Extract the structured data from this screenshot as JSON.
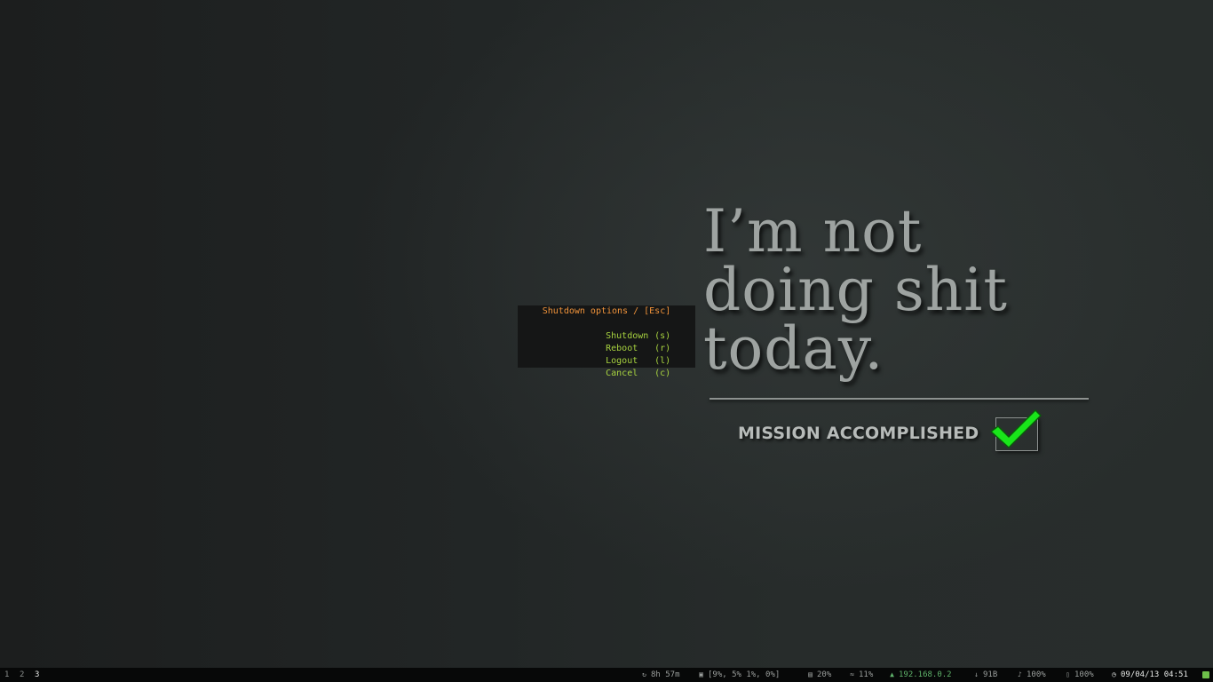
{
  "wallpaper": {
    "headline": [
      "I’m not",
      "doing shit",
      "today."
    ],
    "tagline": "MISSION ACCOMPLISHED",
    "check_color": "#19e61a"
  },
  "dialog": {
    "title": "Shutdown options / [Esc]",
    "items": [
      {
        "label": "Shutdown",
        "key": "(s)"
      },
      {
        "label": "Reboot",
        "key": "(r)"
      },
      {
        "label": "Logout",
        "key": "(l)"
      },
      {
        "label": "Cancel",
        "key": "(c)"
      }
    ],
    "title_color": "#f0933a",
    "item_color": "#a7d23f"
  },
  "statusbar": {
    "workspaces": [
      "1",
      "2",
      "3"
    ],
    "active_workspace": "3",
    "uptime": {
      "icon": "uptime-icon",
      "value": "8h 57m"
    },
    "cpu": {
      "icon": "cpu-icon",
      "value": "[9%, 5%  1%, 0%]"
    },
    "memory": {
      "icon": "memory-icon",
      "value": "20%"
    },
    "swap": {
      "icon": "swap-icon",
      "value": "11%"
    },
    "network": {
      "icon": "wifi-icon",
      "value": "192.168.0.2"
    },
    "download": {
      "icon": "download-arrow-icon",
      "value": "91B"
    },
    "volume": {
      "icon": "speaker-icon",
      "value": "100%"
    },
    "battery": {
      "icon": "battery-icon",
      "value": "100%"
    },
    "clock": {
      "icon": "clock-icon",
      "value": "09/04/13 04:51"
    }
  }
}
